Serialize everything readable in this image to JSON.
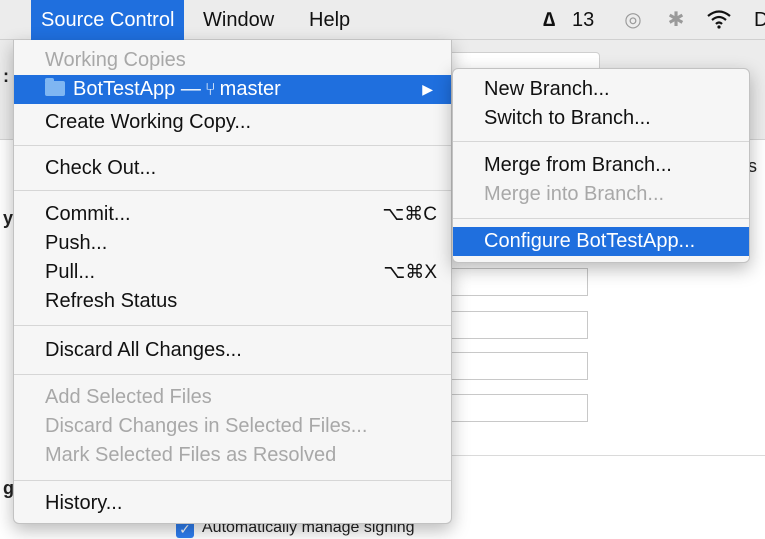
{
  "menubar": {
    "items": [
      "Source Control",
      "Window",
      "Help"
    ],
    "adobe_count": "13",
    "right_fragment": "D"
  },
  "source_control_menu": {
    "working_copies_header": "Working Copies",
    "project_item": "BotTestApp —",
    "branch_name": "master",
    "create_working_copy": "Create Working Copy...",
    "check_out": "Check Out...",
    "commit": "Commit...",
    "commit_shortcut": "⌥⌘C",
    "push": "Push...",
    "pull": "Pull...",
    "pull_shortcut": "⌥⌘X",
    "refresh_status": "Refresh Status",
    "discard_all": "Discard All Changes...",
    "add_selected": "Add Selected Files",
    "discard_selected": "Discard Changes in Selected Files...",
    "mark_resolved": "Mark Selected Files as Resolved",
    "history": "History..."
  },
  "branch_submenu": {
    "new_branch": "New Branch...",
    "switch_branch": "Switch to Branch...",
    "merge_from": "Merge from Branch...",
    "merge_into": "Merge into Branch...",
    "configure": "Configure BotTestApp..."
  },
  "background": {
    "checkbox_label": "Automatically manage signing"
  },
  "colors": {
    "highlight": "#1f6fde",
    "disabled_text": "#a8a8a8"
  }
}
